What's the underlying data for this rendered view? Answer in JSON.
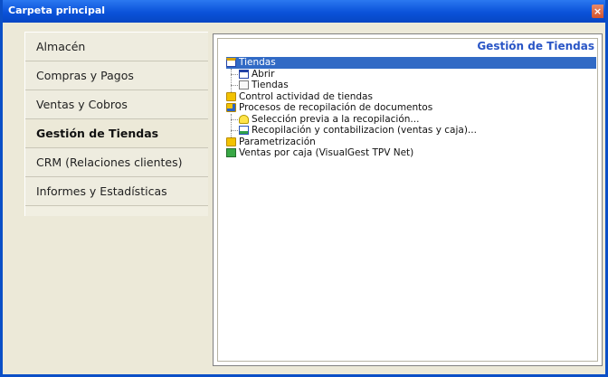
{
  "window": {
    "title": "Carpeta principal",
    "close_glyph": "×"
  },
  "nav": {
    "items": [
      {
        "label": "Almacén",
        "active": false
      },
      {
        "label": "Compras y Pagos",
        "active": false
      },
      {
        "label": "Ventas y Cobros",
        "active": false
      },
      {
        "label": "Gestión de Tiendas",
        "active": true
      },
      {
        "label": "CRM (Relaciones clientes)",
        "active": false
      },
      {
        "label": "Informes y Estadísticas",
        "active": false
      }
    ]
  },
  "panel": {
    "title": "Gestión de Tiendas",
    "tree": [
      {
        "label": "Tiendas",
        "icon": "table-icon",
        "level": 1,
        "selected": true
      },
      {
        "label": "Abrir",
        "icon": "table-icon",
        "level": 2,
        "selected": false
      },
      {
        "label": "Tiendas",
        "icon": "document-icon",
        "level": 2,
        "selected": false
      },
      {
        "label": "Control actividad de tiendas",
        "icon": "folder-icon",
        "level": 1,
        "selected": false
      },
      {
        "label": "Procesos de recopilación de documentos",
        "icon": "folder-gear-icon",
        "level": 1,
        "selected": false
      },
      {
        "label": "Selección previa a la recopilación...",
        "icon": "lightbulb-icon",
        "level": 2,
        "selected": false
      },
      {
        "label": "Recopilación y contabilizacion (ventas y caja)...",
        "icon": "report-icon",
        "level": 2,
        "selected": false
      },
      {
        "label": "Parametrización",
        "icon": "folder-icon",
        "level": 1,
        "selected": false
      },
      {
        "label": "Ventas por caja (VisualGest TPV Net)",
        "icon": "green-grid-icon",
        "level": 1,
        "selected": false
      }
    ]
  }
}
